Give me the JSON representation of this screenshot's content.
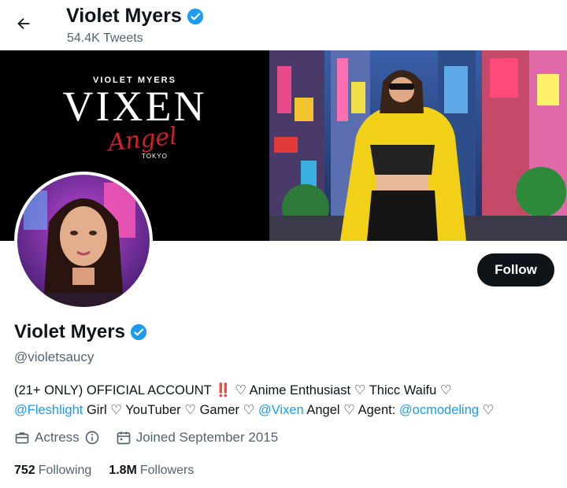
{
  "header": {
    "back_icon": "arrow-left-icon",
    "name": "Violet Myers",
    "tweets_count": "54.4K Tweets"
  },
  "banner": {
    "brand_small": "VIOLET MYERS",
    "brand_big": "VIXEN",
    "brand_script": "Angel",
    "brand_tokyo": "TOKYO"
  },
  "profile": {
    "name": "Violet Myers",
    "handle": "@violetsaucy",
    "follow_label": "Follow",
    "verified_color": "#1d9bf0",
    "bio": {
      "part1": "(21+ ONLY) OFFICIAL ACCOUNT",
      "bang": "‼️",
      "part2": " ♡ Anime Enthusiast ♡ Thicc Waifu ♡",
      "link1": "@Fleshlight",
      "part3": " Girl ♡ YouTuber ♡ Gamer ♡ ",
      "link2": "@Vixen",
      "part4": " Angel ♡  Agent: ",
      "link3": "@ocmodeling",
      "part5": " ♡"
    },
    "category": "Actress",
    "joined": "Joined September 2015",
    "following_count": "752",
    "following_label": "Following",
    "followers_count": "1.8M",
    "followers_label": "Followers"
  }
}
